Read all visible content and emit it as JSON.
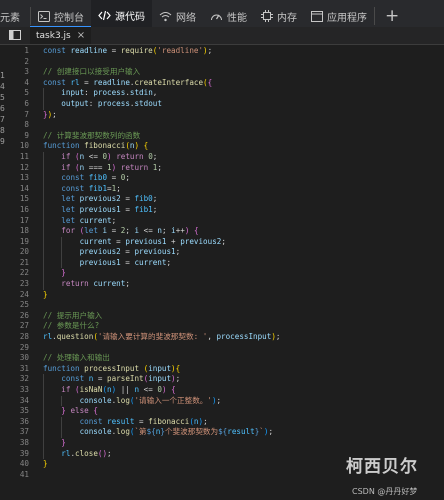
{
  "devtools_tabs": [
    {
      "label": "元素",
      "icon": "elements-icon"
    },
    {
      "label": "控制台",
      "icon": "console-icon"
    },
    {
      "label": "源代码",
      "icon": "sources-icon",
      "active": true
    },
    {
      "label": "网络",
      "icon": "network-icon"
    },
    {
      "label": "性能",
      "icon": "performance-icon"
    },
    {
      "label": "内存",
      "icon": "memory-icon"
    },
    {
      "label": "应用程序",
      "icon": "application-icon"
    }
  ],
  "add_tab_label": "+",
  "file_tab": {
    "name": "task3.js",
    "close": "×"
  },
  "left_digits": [
    "1",
    "4",
    "5",
    "6",
    "7",
    "8",
    "9"
  ],
  "colors": {
    "active_tab_underline": "#7cacf8",
    "editor_bg": "#1e1e1e",
    "tabbar_bg": "#292a2d"
  },
  "code_lines": [
    {
      "n": "1",
      "t": [
        [
          "kw",
          "const "
        ],
        [
          "var",
          "readline"
        ],
        [
          "pn",
          " = "
        ],
        [
          "fn",
          "require"
        ],
        [
          "br1",
          "("
        ],
        [
          "str",
          "'readline'"
        ],
        [
          "br1",
          ")"
        ],
        [
          "pn",
          ";"
        ]
      ]
    },
    {
      "n": "2",
      "t": []
    },
    {
      "n": "3",
      "t": [
        [
          "cmt",
          "// 创建接口以接受用户输入"
        ]
      ]
    },
    {
      "n": "4",
      "t": [
        [
          "kw",
          "const "
        ],
        [
          "cst",
          "rl"
        ],
        [
          "pn",
          " = "
        ],
        [
          "var",
          "readline"
        ],
        [
          "pn",
          "."
        ],
        [
          "fn",
          "createInterface"
        ],
        [
          "br1",
          "("
        ],
        [
          "br2",
          "{"
        ]
      ]
    },
    {
      "n": "5",
      "t": [
        [
          "pn",
          "    "
        ],
        [
          "var",
          "input"
        ],
        [
          "pn",
          ": "
        ],
        [
          "var",
          "process"
        ],
        [
          "pn",
          "."
        ],
        [
          "var",
          "stdin"
        ],
        [
          "pn",
          ","
        ]
      ]
    },
    {
      "n": "6",
      "t": [
        [
          "pn",
          "    "
        ],
        [
          "var",
          "output"
        ],
        [
          "pn",
          ": "
        ],
        [
          "var",
          "process"
        ],
        [
          "pn",
          "."
        ],
        [
          "var",
          "stdout"
        ]
      ]
    },
    {
      "n": "7",
      "t": [
        [
          "br2",
          "}"
        ],
        [
          "br1",
          ")"
        ],
        [
          "pn",
          ";"
        ]
      ]
    },
    {
      "n": "8",
      "t": []
    },
    {
      "n": "9",
      "t": [
        [
          "cmt",
          "// 计算斐波那契数列的函数"
        ]
      ]
    },
    {
      "n": "10",
      "t": [
        [
          "kw",
          "function "
        ],
        [
          "fn",
          "fibonacci"
        ],
        [
          "br1",
          "("
        ],
        [
          "var",
          "n"
        ],
        [
          "br1",
          ")"
        ],
        [
          "pn",
          " "
        ],
        [
          "br1",
          "{"
        ]
      ]
    },
    {
      "n": "11",
      "t": [
        [
          "pn",
          "    "
        ],
        [
          "ctl",
          "if "
        ],
        [
          "br2",
          "("
        ],
        [
          "var",
          "n"
        ],
        [
          "pn",
          " <= "
        ],
        [
          "num",
          "0"
        ],
        [
          "br2",
          ")"
        ],
        [
          "pn",
          " "
        ],
        [
          "ctl",
          "return "
        ],
        [
          "num",
          "0"
        ],
        [
          "pn",
          ";"
        ]
      ]
    },
    {
      "n": "12",
      "t": [
        [
          "pn",
          "    "
        ],
        [
          "ctl",
          "if "
        ],
        [
          "br2",
          "("
        ],
        [
          "var",
          "n"
        ],
        [
          "pn",
          " === "
        ],
        [
          "num",
          "1"
        ],
        [
          "br2",
          ")"
        ],
        [
          "pn",
          " "
        ],
        [
          "ctl",
          "return "
        ],
        [
          "num",
          "1"
        ],
        [
          "pn",
          ";"
        ]
      ]
    },
    {
      "n": "13",
      "t": [
        [
          "pn",
          "    "
        ],
        [
          "kw",
          "const "
        ],
        [
          "cst",
          "fib0"
        ],
        [
          "pn",
          " = "
        ],
        [
          "num",
          "0"
        ],
        [
          "pn",
          ";"
        ]
      ]
    },
    {
      "n": "14",
      "t": [
        [
          "pn",
          "    "
        ],
        [
          "kw",
          "const "
        ],
        [
          "cst",
          "fib1"
        ],
        [
          "pn",
          "="
        ],
        [
          "num",
          "1"
        ],
        [
          "pn",
          ";"
        ]
      ]
    },
    {
      "n": "15",
      "t": [
        [
          "pn",
          "    "
        ],
        [
          "kw",
          "let "
        ],
        [
          "var",
          "previous2"
        ],
        [
          "pn",
          " = "
        ],
        [
          "cst",
          "fib0"
        ],
        [
          "pn",
          ";"
        ]
      ]
    },
    {
      "n": "16",
      "t": [
        [
          "pn",
          "    "
        ],
        [
          "kw",
          "let "
        ],
        [
          "var",
          "previous1"
        ],
        [
          "pn",
          " = "
        ],
        [
          "cst",
          "fib1"
        ],
        [
          "pn",
          ";"
        ]
      ]
    },
    {
      "n": "17",
      "t": [
        [
          "pn",
          "    "
        ],
        [
          "kw",
          "let "
        ],
        [
          "var",
          "current"
        ],
        [
          "pn",
          ";"
        ]
      ]
    },
    {
      "n": "18",
      "t": [
        [
          "pn",
          "    "
        ],
        [
          "ctl",
          "for "
        ],
        [
          "br2",
          "("
        ],
        [
          "kw",
          "let "
        ],
        [
          "var",
          "i"
        ],
        [
          "pn",
          " = "
        ],
        [
          "num",
          "2"
        ],
        [
          "pn",
          "; "
        ],
        [
          "var",
          "i"
        ],
        [
          "pn",
          " <= "
        ],
        [
          "var",
          "n"
        ],
        [
          "pn",
          "; "
        ],
        [
          "var",
          "i"
        ],
        [
          "pn",
          "++"
        ],
        [
          "br2",
          ")"
        ],
        [
          "pn",
          " "
        ],
        [
          "br2",
          "{"
        ]
      ]
    },
    {
      "n": "19",
      "t": [
        [
          "pn",
          "        "
        ],
        [
          "var",
          "current"
        ],
        [
          "pn",
          " = "
        ],
        [
          "var",
          "previous1"
        ],
        [
          "pn",
          " + "
        ],
        [
          "var",
          "previous2"
        ],
        [
          "pn",
          ";"
        ]
      ]
    },
    {
      "n": "20",
      "t": [
        [
          "pn",
          "        "
        ],
        [
          "var",
          "previous2"
        ],
        [
          "pn",
          " = "
        ],
        [
          "var",
          "previous1"
        ],
        [
          "pn",
          ";"
        ]
      ]
    },
    {
      "n": "21",
      "t": [
        [
          "pn",
          "        "
        ],
        [
          "var",
          "previous1"
        ],
        [
          "pn",
          " = "
        ],
        [
          "var",
          "current"
        ],
        [
          "pn",
          ";"
        ]
      ]
    },
    {
      "n": "22",
      "t": [
        [
          "pn",
          "    "
        ],
        [
          "br2",
          "}"
        ]
      ]
    },
    {
      "n": "23",
      "t": [
        [
          "pn",
          "    "
        ],
        [
          "ctl",
          "return "
        ],
        [
          "var",
          "current"
        ],
        [
          "pn",
          ";"
        ]
      ]
    },
    {
      "n": "24",
      "t": [
        [
          "br1",
          "}"
        ]
      ]
    },
    {
      "n": "25",
      "t": []
    },
    {
      "n": "26",
      "t": [
        [
          "cmt",
          "// 提示用户输入"
        ]
      ]
    },
    {
      "n": "27",
      "t": [
        [
          "cmt",
          "// 参数是什么?"
        ]
      ]
    },
    {
      "n": "28",
      "t": [
        [
          "cst",
          "rl"
        ],
        [
          "pn",
          "."
        ],
        [
          "fn",
          "question"
        ],
        [
          "br1",
          "("
        ],
        [
          "str",
          "'请输入要计算的斐波那契数: '"
        ],
        [
          "pn",
          ", "
        ],
        [
          "var",
          "processInput"
        ],
        [
          "br1",
          ")"
        ],
        [
          "pn",
          ";"
        ]
      ]
    },
    {
      "n": "29",
      "t": []
    },
    {
      "n": "30",
      "t": [
        [
          "cmt",
          "// 处理输入和输出"
        ]
      ]
    },
    {
      "n": "31",
      "t": [
        [
          "kw",
          "function "
        ],
        [
          "fn",
          "processInput"
        ],
        [
          "pn",
          " "
        ],
        [
          "br1",
          "("
        ],
        [
          "var",
          "input"
        ],
        [
          "br1",
          ")"
        ],
        [
          "br1",
          "{"
        ]
      ]
    },
    {
      "n": "32",
      "t": [
        [
          "pn",
          "    "
        ],
        [
          "kw",
          "const "
        ],
        [
          "cst",
          "n"
        ],
        [
          "pn",
          " = "
        ],
        [
          "fn",
          "parseInt"
        ],
        [
          "br2",
          "("
        ],
        [
          "var",
          "input"
        ],
        [
          "br2",
          ")"
        ],
        [
          "pn",
          ";"
        ]
      ]
    },
    {
      "n": "33",
      "t": [
        [
          "pn",
          "    "
        ],
        [
          "ctl",
          "if "
        ],
        [
          "br2",
          "("
        ],
        [
          "fn",
          "isNaN"
        ],
        [
          "br3",
          "("
        ],
        [
          "cst",
          "n"
        ],
        [
          "br3",
          ")"
        ],
        [
          "pn",
          " || "
        ],
        [
          "cst",
          "n"
        ],
        [
          "pn",
          " <= "
        ],
        [
          "num",
          "0"
        ],
        [
          "br2",
          ")"
        ],
        [
          "pn",
          " "
        ],
        [
          "br2",
          "{"
        ]
      ]
    },
    {
      "n": "34",
      "t": [
        [
          "pn",
          "        "
        ],
        [
          "var",
          "console"
        ],
        [
          "pn",
          "."
        ],
        [
          "fn",
          "log"
        ],
        [
          "br3",
          "("
        ],
        [
          "str",
          "'请输入一个正整数。'"
        ],
        [
          "br3",
          ")"
        ],
        [
          "pn",
          ";"
        ]
      ]
    },
    {
      "n": "35",
      "t": [
        [
          "pn",
          "    "
        ],
        [
          "br2",
          "}"
        ],
        [
          "pn",
          " "
        ],
        [
          "ctl",
          "else "
        ],
        [
          "br2",
          "{"
        ]
      ]
    },
    {
      "n": "36",
      "t": [
        [
          "pn",
          "        "
        ],
        [
          "kw",
          "const "
        ],
        [
          "cst",
          "result"
        ],
        [
          "pn",
          " = "
        ],
        [
          "fn",
          "fibonacci"
        ],
        [
          "br3",
          "("
        ],
        [
          "cst",
          "n"
        ],
        [
          "br3",
          ")"
        ],
        [
          "pn",
          ";"
        ]
      ]
    },
    {
      "n": "37",
      "t": [
        [
          "pn",
          "        "
        ],
        [
          "var",
          "console"
        ],
        [
          "pn",
          "."
        ],
        [
          "fn",
          "log"
        ],
        [
          "br3",
          "("
        ],
        [
          "str",
          "`第"
        ],
        [
          "kw",
          "${"
        ],
        [
          "cst",
          "n"
        ],
        [
          "kw",
          "}"
        ],
        [
          "str",
          "个斐波那契数为"
        ],
        [
          "kw",
          "${"
        ],
        [
          "cst",
          "result"
        ],
        [
          "kw",
          "}"
        ],
        [
          "str",
          "`"
        ],
        [
          "br3",
          ")"
        ],
        [
          "pn",
          ";"
        ]
      ]
    },
    {
      "n": "38",
      "t": [
        [
          "pn",
          "    "
        ],
        [
          "br2",
          "}"
        ]
      ]
    },
    {
      "n": "39",
      "t": [
        [
          "pn",
          "    "
        ],
        [
          "cst",
          "rl"
        ],
        [
          "pn",
          "."
        ],
        [
          "fn",
          "close"
        ],
        [
          "br2",
          "()"
        ],
        [
          "pn",
          ";"
        ]
      ]
    },
    {
      "n": "40",
      "t": [
        [
          "br1",
          "}"
        ]
      ]
    },
    {
      "n": "41",
      "t": []
    }
  ],
  "watermark": "柯西贝尔",
  "credit": "CSDN @丹丹好梦"
}
